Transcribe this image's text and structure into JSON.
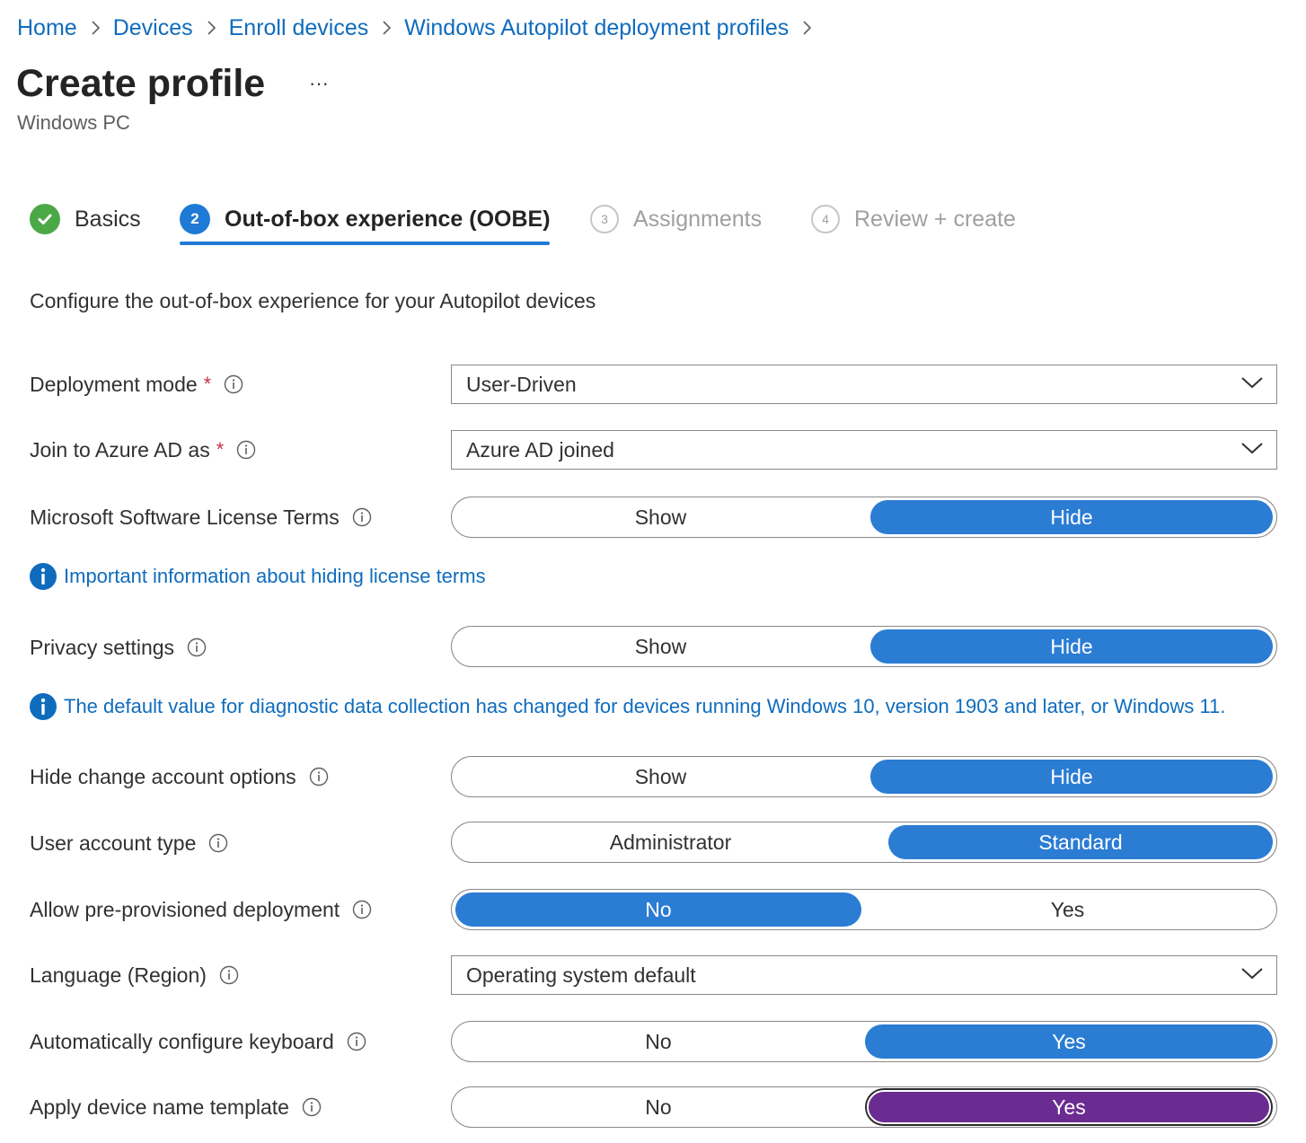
{
  "breadcrumb": [
    "Home",
    "Devices",
    "Enroll devices",
    "Windows Autopilot deployment profiles"
  ],
  "header": {
    "title": "Create profile",
    "more_label": "···",
    "subtitle": "Windows PC"
  },
  "wizard": {
    "tabs": [
      {
        "label": "Basics",
        "state": "completed",
        "step": ""
      },
      {
        "label": "Out-of-box experience (OOBE)",
        "state": "active",
        "step": "2"
      },
      {
        "label": "Assignments",
        "state": "pending",
        "step": "3"
      },
      {
        "label": "Review + create",
        "state": "pending",
        "step": "4"
      }
    ]
  },
  "intro": "Configure the out-of-box experience for your Autopilot devices",
  "settings": {
    "deployment_mode": {
      "label": "Deployment mode",
      "required": "*",
      "value": "User-Driven"
    },
    "join_azure": {
      "label": "Join to Azure AD as",
      "required": "*",
      "value": "Azure AD joined"
    },
    "license_terms": {
      "label": "Microsoft Software License Terms",
      "options": [
        "Show",
        "Hide"
      ],
      "selected": "Hide"
    },
    "license_info": "Important information about hiding license terms",
    "privacy": {
      "label": "Privacy settings",
      "options": [
        "Show",
        "Hide"
      ],
      "selected": "Hide"
    },
    "privacy_info": "The default value for diagnostic data collection has changed for devices running Windows 10, version 1903 and later, or Windows 11.",
    "change_account": {
      "label": "Hide change account options",
      "options": [
        "Show",
        "Hide"
      ],
      "selected": "Hide"
    },
    "account_type": {
      "label": "User account type",
      "options": [
        "Administrator",
        "Standard"
      ],
      "selected": "Standard"
    },
    "preprovisioned": {
      "label": "Allow pre-provisioned deployment",
      "options": [
        "No",
        "Yes"
      ],
      "selected": "No"
    },
    "language": {
      "label": "Language (Region)",
      "value": "Operating system default"
    },
    "keyboard": {
      "label": "Automatically configure keyboard",
      "options": [
        "No",
        "Yes"
      ],
      "selected": "Yes"
    },
    "device_name": {
      "label": "Apply device name template",
      "options": [
        "No",
        "Yes"
      ],
      "selected": "Yes"
    }
  },
  "colors": {
    "link": "#0f6cbd",
    "toggle_selected": "#2b7cd3",
    "toggle_focused": "#6b2c91",
    "completed_check": "#4ba846",
    "required": "#c4314b"
  }
}
